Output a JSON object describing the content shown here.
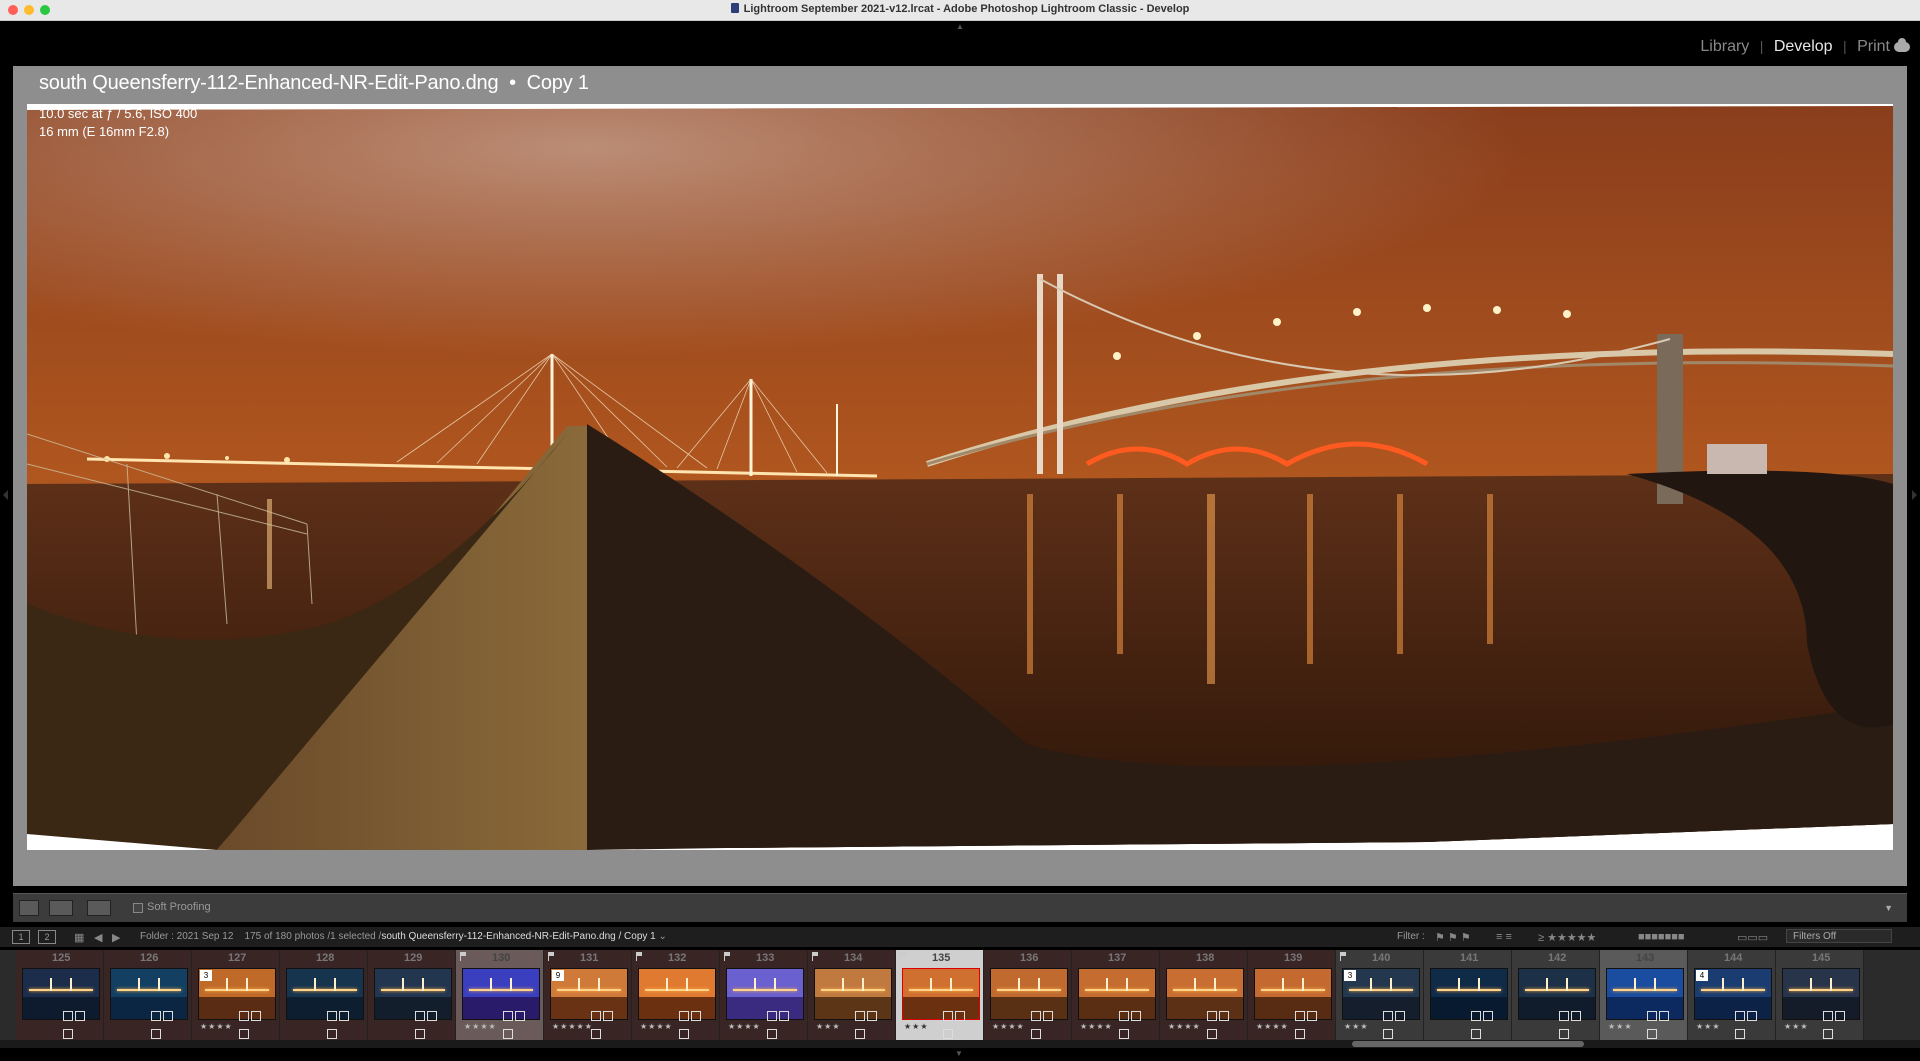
{
  "window": {
    "title": "Lightroom September 2021-v12.lrcat - Adobe Photoshop Lightroom Classic - Develop"
  },
  "modules": {
    "library": "Library",
    "develop": "Develop",
    "print": "Print",
    "separator": "|"
  },
  "photo": {
    "filename": "south Queensferry-112-Enhanced-NR-Edit-Pano.dng",
    "separator": "•",
    "copy": "Copy 1",
    "exposure": "10.0 sec at ƒ / 5.6, ISO 400",
    "lens": "16 mm (E 16mm F2.8)"
  },
  "toolbar": {
    "soft_proofing": "Soft Proofing"
  },
  "filmstrip_bar": {
    "screen1": "1",
    "screen2": "2",
    "folder": "Folder : 2021 Sep 12",
    "count": "175 of 180 photos /1 selected /",
    "selected_path": "south Queensferry-112-Enhanced-NR-Edit-Pano.dng / Copy 1",
    "filter_label": "Filter :",
    "filters_off": "Filters Off"
  },
  "filmstrip": [
    {
      "num": "125",
      "badge": "",
      "stars": "",
      "flag": false,
      "sky": "#1b2d4a",
      "water": "#0e1b2e",
      "bg": "#3a2525"
    },
    {
      "num": "126",
      "badge": "",
      "stars": "",
      "flag": false,
      "sky": "#134062",
      "water": "#0a2642",
      "bg": "#3a2525"
    },
    {
      "num": "127",
      "badge": "3",
      "stars": "★★★★",
      "flag": false,
      "sky": "#c06a2a",
      "water": "#5a2c14",
      "bg": "#3a2525"
    },
    {
      "num": "128",
      "badge": "",
      "stars": "",
      "flag": false,
      "sky": "#17344f",
      "water": "#0d1e30",
      "bg": "#3a2525"
    },
    {
      "num": "129",
      "badge": "",
      "stars": "",
      "flag": false,
      "sky": "#223650",
      "water": "#121e2c",
      "bg": "#3a2525"
    },
    {
      "num": "130",
      "badge": "",
      "stars": "★★★★",
      "flag": true,
      "sky": "#3a3fc0",
      "water": "#2a1a6a",
      "bg": "#6a5a5a"
    },
    {
      "num": "131",
      "badge": "9",
      "stars": "★★★★★",
      "flag": true,
      "sky": "#d07a3a",
      "water": "#6a3214",
      "bg": "#3a2525"
    },
    {
      "num": "132",
      "badge": "",
      "stars": "★★★★",
      "flag": true,
      "sky": "#e07a30",
      "water": "#6a3010",
      "bg": "#3a2525"
    },
    {
      "num": "133",
      "badge": "",
      "stars": "★★★★",
      "flag": true,
      "sky": "#6a60d0",
      "water": "#3a2a80",
      "bg": "#3a2525"
    },
    {
      "num": "134",
      "badge": "",
      "stars": "★★★",
      "flag": true,
      "sky": "#c07a40",
      "water": "#5c3416",
      "bg": "#3a2525"
    },
    {
      "num": "135",
      "badge": "",
      "stars": "★★★",
      "flag": true,
      "sky": "#d07030",
      "water": "#6a3010",
      "bg": "#cfcfcf"
    },
    {
      "num": "136",
      "badge": "",
      "stars": "★★★★",
      "flag": false,
      "sky": "#c06a30",
      "water": "#5a3014",
      "bg": "#3a2525"
    },
    {
      "num": "137",
      "badge": "",
      "stars": "★★★★",
      "flag": false,
      "sky": "#c56c30",
      "water": "#5a2e12",
      "bg": "#3a2525"
    },
    {
      "num": "138",
      "badge": "",
      "stars": "★★★★",
      "flag": false,
      "sky": "#c86e32",
      "water": "#5c3014",
      "bg": "#3a2525"
    },
    {
      "num": "139",
      "badge": "",
      "stars": "★★★★",
      "flag": false,
      "sky": "#c46a30",
      "water": "#582c12",
      "bg": "#3a2525"
    },
    {
      "num": "140",
      "badge": "3",
      "stars": "★★★",
      "flag": true,
      "sky": "#23384f",
      "water": "#141e2c",
      "bg": "#3a3a3a"
    },
    {
      "num": "141",
      "badge": "",
      "stars": "",
      "flag": false,
      "sky": "#102b48",
      "water": "#081a30",
      "bg": "#3a3a3a"
    },
    {
      "num": "142",
      "badge": "",
      "stars": "",
      "flag": false,
      "sky": "#1c3048",
      "water": "#101c2c",
      "bg": "#3a3a3a"
    },
    {
      "num": "143",
      "badge": "",
      "stars": "★★★",
      "flag": false,
      "sky": "#1a4ca0",
      "water": "#0c2a60",
      "bg": "#5a5a5a"
    },
    {
      "num": "144",
      "badge": "4",
      "stars": "★★★",
      "flag": false,
      "sky": "#1a3c70",
      "water": "#0c2246",
      "bg": "#3a3a3a"
    },
    {
      "num": "145",
      "badge": "",
      "stars": "★★★",
      "flag": false,
      "sky": "#28344a",
      "water": "#141c2a",
      "bg": "#3a3a3a"
    }
  ]
}
